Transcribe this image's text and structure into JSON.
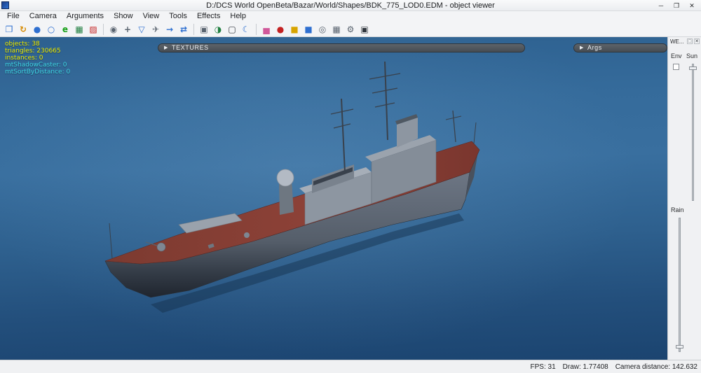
{
  "window": {
    "title": "D:/DCS World OpenBeta/Bazar/World/Shapes/BDK_775_LOD0.EDM - object viewer",
    "controls": {
      "minimize": "─",
      "maximize": "❐",
      "close": "✕"
    }
  },
  "menubar": {
    "items": [
      "File",
      "Camera",
      "Arguments",
      "Show",
      "View",
      "Tools",
      "Effects",
      "Help"
    ]
  },
  "toolbar": {
    "icons": [
      {
        "name": "open-model-icon",
        "glyph": "❐"
      },
      {
        "name": "refresh-icon",
        "glyph": "↻"
      },
      {
        "name": "sphere-icon",
        "glyph": "●"
      },
      {
        "name": "globe-icon",
        "glyph": "○"
      },
      {
        "name": "browser-icon",
        "glyph": "e"
      },
      {
        "name": "excel-export-icon",
        "glyph": "▦"
      },
      {
        "name": "pdf-export-icon",
        "glyph": "▨"
      },
      {
        "name": "camera-icon",
        "glyph": "◉"
      },
      {
        "name": "move-tool-icon",
        "glyph": "+"
      },
      {
        "name": "filter-icon",
        "glyph": "▽"
      },
      {
        "name": "aircraft-icon",
        "glyph": "✈"
      },
      {
        "name": "forward-icon",
        "glyph": "→"
      },
      {
        "name": "swap-icon",
        "glyph": "⇄"
      },
      {
        "name": "image-icon",
        "glyph": "▣"
      },
      {
        "name": "render-mode-icon",
        "glyph": "◑"
      },
      {
        "name": "display-icon",
        "glyph": "▢"
      },
      {
        "name": "night-mode-icon",
        "glyph": "☾"
      },
      {
        "name": "chart-icon",
        "glyph": "▅"
      },
      {
        "name": "record-icon",
        "glyph": "●"
      },
      {
        "name": "package-yellow-icon",
        "glyph": "■"
      },
      {
        "name": "package-blue-icon",
        "glyph": "■"
      },
      {
        "name": "search-icon",
        "glyph": "◎"
      },
      {
        "name": "grid-icon",
        "glyph": "▦"
      },
      {
        "name": "tools-icon",
        "glyph": "⚙"
      },
      {
        "name": "snapshot-icon",
        "glyph": "▣"
      }
    ]
  },
  "viewport": {
    "stats": [
      "objects: 38",
      "triangles: 230665",
      "instances: 0",
      "mtShadowCaster: 0",
      "mtSortByDistance: 0"
    ],
    "panels": {
      "textures": {
        "arrow": "▶",
        "label": "TEXTURES"
      },
      "args": {
        "arrow": "▶",
        "label": "Args"
      }
    }
  },
  "sidebar": {
    "title": "WE...",
    "collapse_glyph": "□",
    "close_glyph": "✕",
    "env_label": "Env",
    "sun_label": "Sun",
    "rain_label": "Rain"
  },
  "statusbar": {
    "fps": "FPS: 31",
    "draw": "Draw: 1.77408",
    "camera_distance": "Camera distance: 142.632"
  },
  "colors": {
    "viewport_top": "#33689a",
    "viewport_bottom": "#1b4470",
    "stats_yellow": "#f0f000",
    "stats_cyan": "#3fd8e8",
    "panel_bar": "#4e545a",
    "deck_red": "#8a4038",
    "hull_gray": "#616a75"
  }
}
